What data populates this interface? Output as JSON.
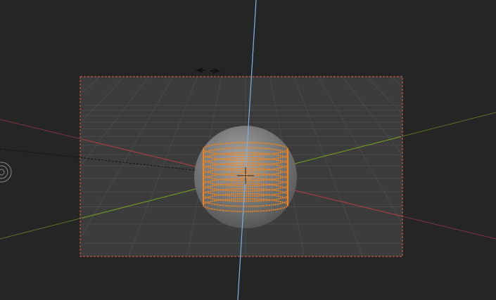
{
  "app": {
    "editor": "3D Viewport",
    "view_mode": "camera-view",
    "shading": "solid"
  },
  "colors": {
    "background": "#252525",
    "camera_frame_fill": "#424242",
    "camera_frame_border": "#e8503a",
    "x_axis": "#9a3a44",
    "y_axis": "#6b8e23",
    "z_axis": "#6fa8dc",
    "selection_orange": "#f0851c",
    "sphere_fill": "#6a6a6a",
    "sphere_highlight": "#a8a8a8",
    "grid_line": "#4d4d4d",
    "gizmo": "#cfcfcf"
  },
  "scene": {
    "objects": [
      {
        "name": "sphere",
        "selected": false
      },
      {
        "name": "coil-mesh",
        "selected": true,
        "rings": 12
      }
    ]
  },
  "icons": {
    "resize_handle": "left-right-arrows-icon",
    "light": "light-lamp-icon",
    "origin": "object-origin-icon"
  }
}
